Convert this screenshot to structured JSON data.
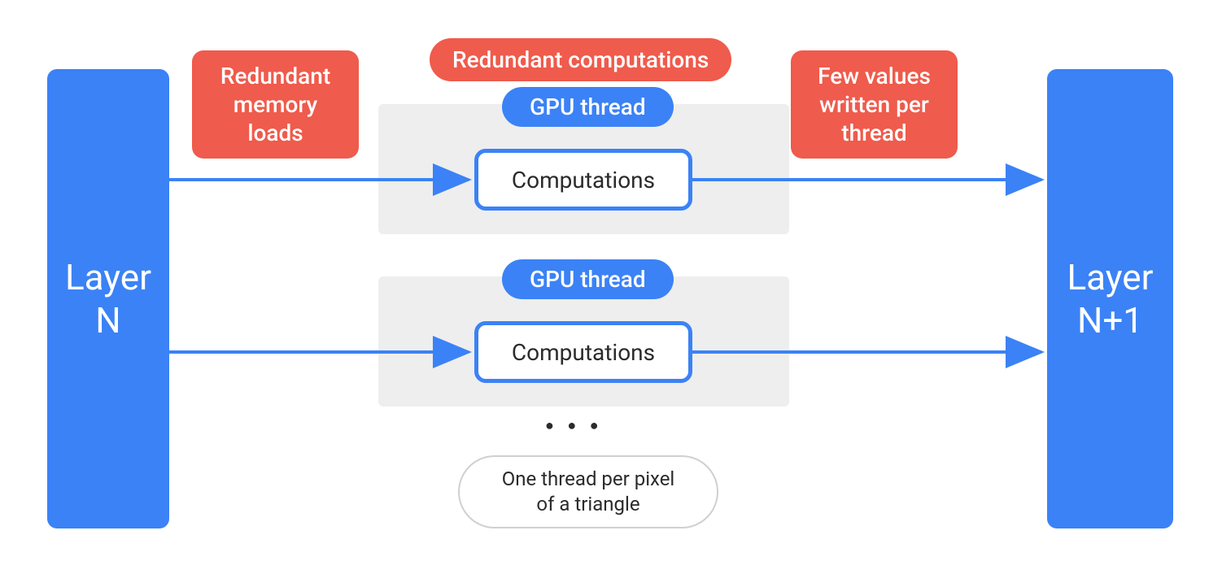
{
  "colors": {
    "blue": "#3b82f6",
    "red": "#ef5b4c",
    "grey": "#eeeeee",
    "text": "#2b2b2b"
  },
  "layer_left": {
    "line1": "Layer",
    "line2": "N"
  },
  "layer_right": {
    "line1": "Layer",
    "line2": "N+1"
  },
  "callout_left": {
    "line1": "Redundant",
    "line2": "memory",
    "line3": "loads"
  },
  "callout_top": "Redundant computations",
  "callout_right": {
    "line1": "Few values",
    "line2": "written per",
    "line3": "thread"
  },
  "gpu_thread_label": "GPU thread",
  "computations_label": "Computations",
  "ellipsis": "● ● ●",
  "footer": {
    "line1": "One thread per pixel",
    "line2": "of a triangle"
  }
}
